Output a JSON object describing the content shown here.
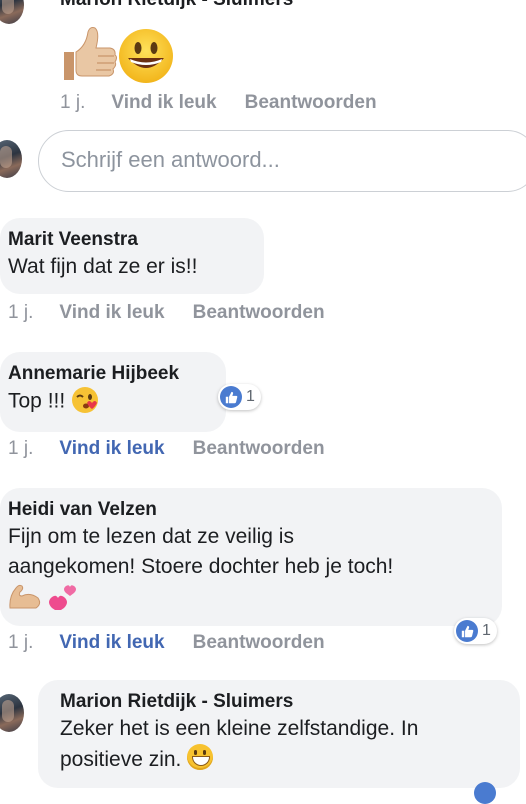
{
  "thread": {
    "top_reply": {
      "author": "Marion Rietdijk - Sluimers",
      "time": "1 j.",
      "like": "Vind ik leuk",
      "reply": "Beantwoorden"
    },
    "reply_box": {
      "placeholder": "Schrijf een antwoord..."
    },
    "comments": [
      {
        "author": "Marit Veenstra",
        "text": "Wat fijn dat ze er is!!",
        "time": "1 j.",
        "like": "Vind ik leuk",
        "reply": "Beantwoorden"
      },
      {
        "author": "Annemarie Hijbeek",
        "text": "Top !!!",
        "time": "1 j.",
        "like": "Vind ik leuk",
        "reply": "Beantwoorden",
        "reaction_count": "1"
      },
      {
        "author": "Heidi van Velzen",
        "text_line1": "Fijn om te lezen dat ze veilig is",
        "text_line2": "aangekomen! Stoere dochter heb je toch!",
        "time": "1 j.",
        "like": "Vind ik leuk",
        "reply": "Beantwoorden",
        "reaction_count": "1"
      }
    ],
    "last_reply": {
      "author": "Marion Rietdijk - Sluimers",
      "text_line1": "Zeker het is een kleine zelfstandige. In",
      "text_line2": "positieve zin."
    }
  },
  "colors": {
    "bubble": "#f2f3f5",
    "meta": "#90949c",
    "liked": "#4267b2",
    "like_badge": "#4a7bd0"
  },
  "icons": [
    "thumbs-up-emoji",
    "grinning-face-emoji",
    "kiss-wink-emoji",
    "flexed-biceps-emoji",
    "two-hearts-emoji",
    "like-badge-icon"
  ]
}
